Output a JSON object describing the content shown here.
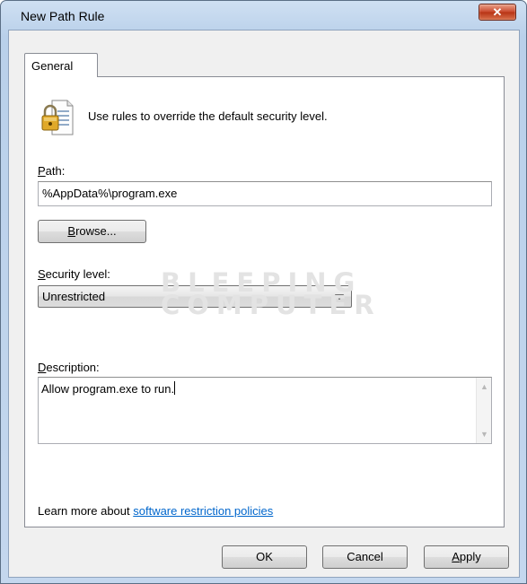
{
  "window": {
    "title": "New Path Rule",
    "close_glyph": "✕"
  },
  "tabs": [
    {
      "label": "General",
      "selected": true
    }
  ],
  "intro_text": "Use rules to override the default security level.",
  "path": {
    "label_accel": "P",
    "label_rest": "ath:",
    "value": "%AppData%\\program.exe",
    "browse_accel": "B",
    "browse_rest": "rowse..."
  },
  "security_level": {
    "label_accel": "S",
    "label_rest": "ecurity level:",
    "selected": "Unrestricted"
  },
  "description": {
    "label_accel": "D",
    "label_rest": "escription:",
    "value": "Allow program.exe to run."
  },
  "learn_more": {
    "prefix": "Learn more about ",
    "link_text": "software restriction policies"
  },
  "buttons": {
    "ok": "OK",
    "cancel": "Cancel",
    "apply_accel": "A",
    "apply_rest": "pply"
  },
  "watermark": {
    "line1": "BLEEPING",
    "line2": "COMPUTER"
  },
  "colors": {
    "link": "#0066cc",
    "window_frame": "#b9d0ea",
    "close_button": "#c9472b"
  },
  "icons": {
    "doc_lock": "document-lock-icon",
    "close": "close-icon",
    "dropdown": "chevron-down-icon"
  }
}
